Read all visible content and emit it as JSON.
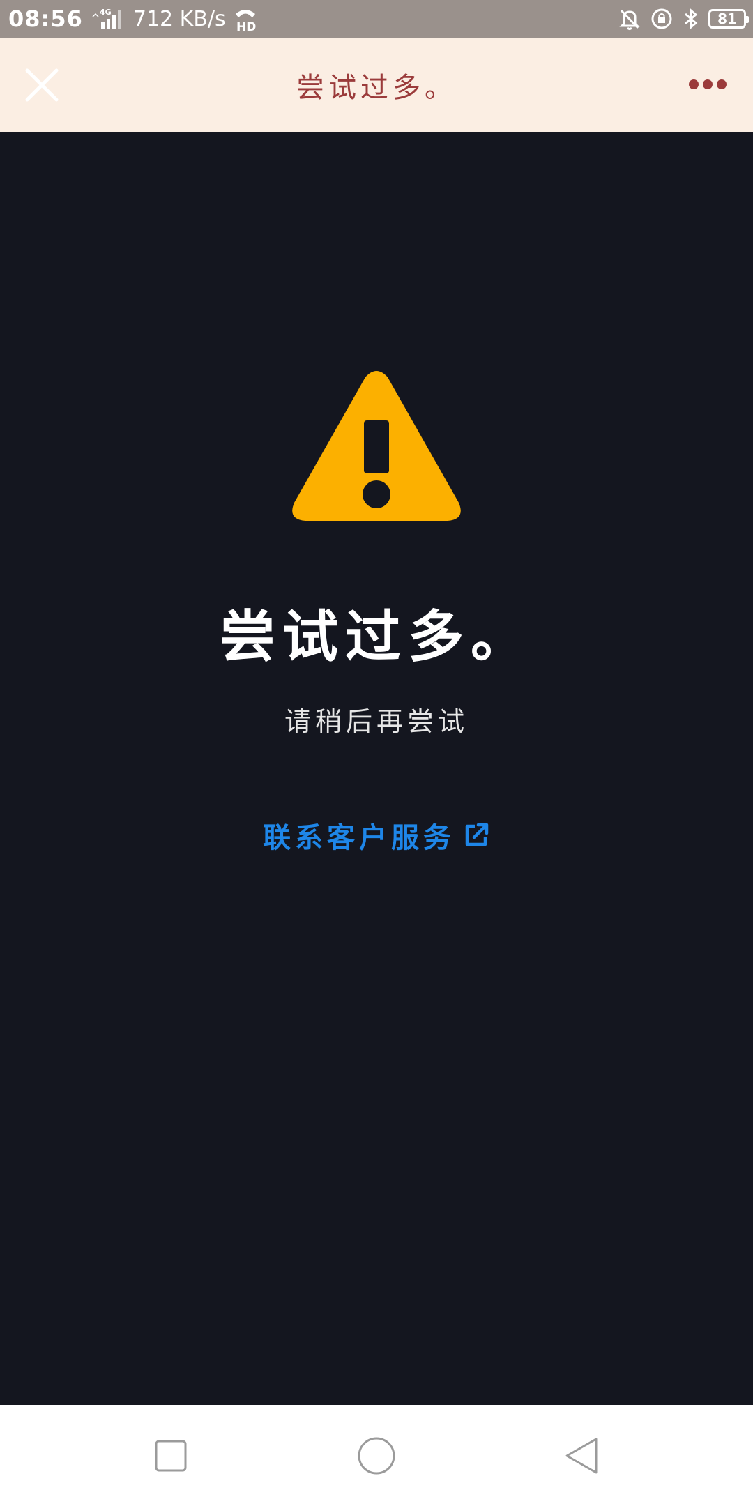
{
  "status_bar": {
    "time": "08:56",
    "network_type": "4G",
    "network_speed": "712 KB/s",
    "hd_label": "HD",
    "battery_level": "81",
    "icons": [
      "signal-icon",
      "hd-call-icon",
      "mute-bell-icon",
      "rotation-lock-icon",
      "bluetooth-icon",
      "battery-icon"
    ]
  },
  "header": {
    "title": "尝试过多。",
    "close_icon": "close-icon",
    "more_icon": "more-dots-icon"
  },
  "main": {
    "icon": "warning-icon",
    "title": "尝试过多。",
    "subtitle": "请稍后再尝试",
    "contact_link": "联系客户服务",
    "contact_icon": "external-link-icon"
  },
  "nav_bar": {
    "icons": [
      "recents-square-icon",
      "home-circle-icon",
      "back-triangle-icon"
    ]
  },
  "colors": {
    "status_bar_bg": "#9a918c",
    "header_bg": "#fbeee3",
    "header_accent": "#9b3b3b",
    "content_bg": "#14161f",
    "warning": "#fcb000",
    "link": "#1e86e8",
    "nav_bg": "#ffffff"
  }
}
